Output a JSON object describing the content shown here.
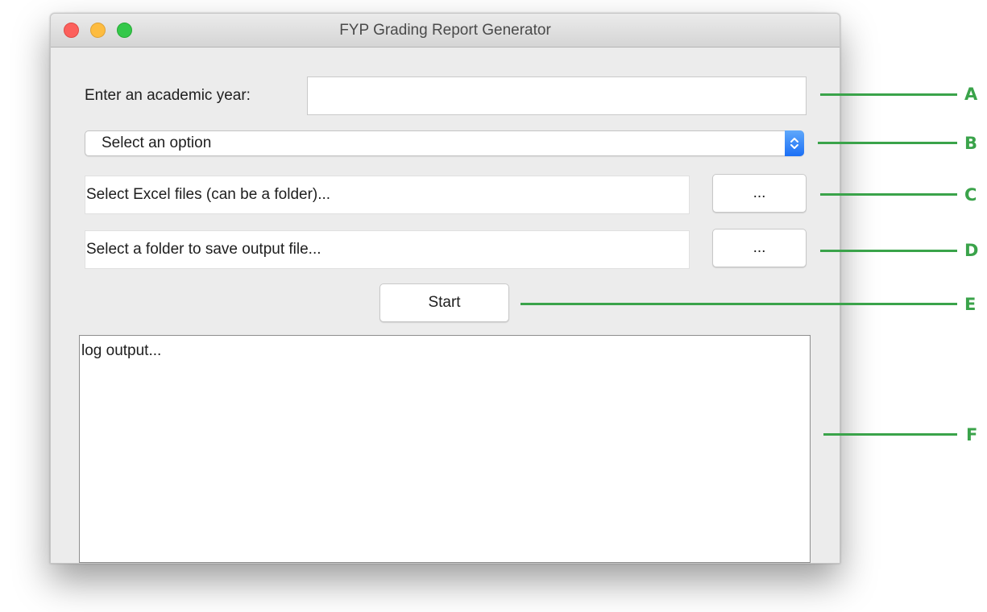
{
  "window": {
    "title": "FYP Grading Report Generator"
  },
  "form": {
    "year_label": "Enter an academic year:",
    "year_value": "",
    "option_selected": "Select an option",
    "excel_path_placeholder": "Select Excel files (can be a folder)...",
    "output_path_placeholder": "Select a folder to save output file...",
    "browse_label": "...",
    "start_label": "Start",
    "log_text": "log output..."
  },
  "annotations": {
    "a": "A",
    "b": "B",
    "c": "C",
    "d": "D",
    "e": "E",
    "f": "F",
    "color": "#3aa34a"
  },
  "colors": {
    "close": "#fc605c",
    "minimize": "#fdbc40",
    "maximize": "#34c84a",
    "select_accent": "#1b6ff5"
  }
}
